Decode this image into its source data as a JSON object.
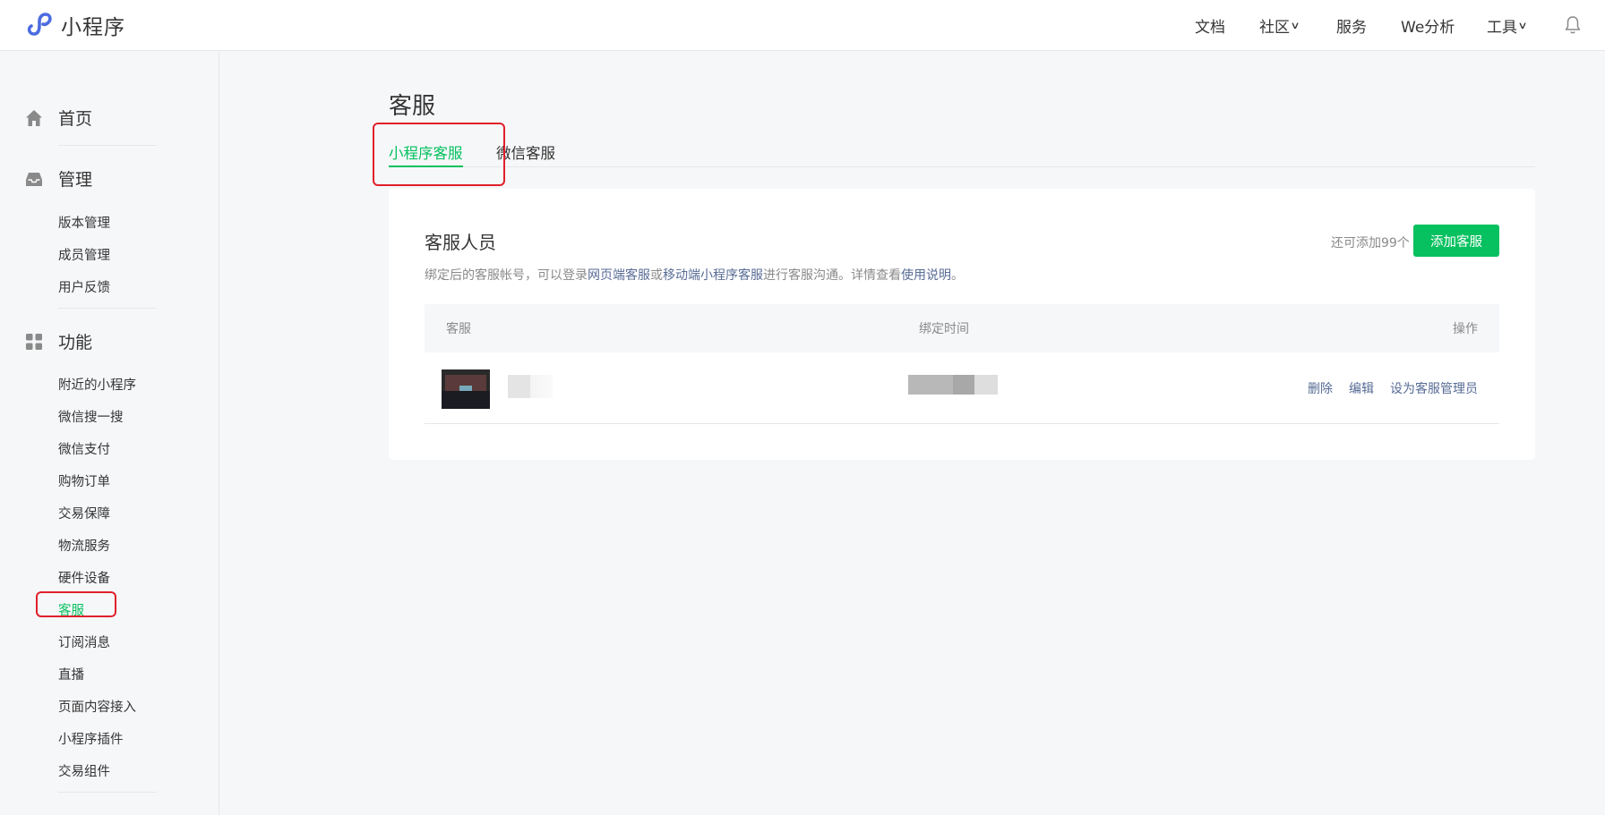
{
  "app": {
    "name": "小程序"
  },
  "topnav": [
    {
      "label": "文档",
      "dropdown": false
    },
    {
      "label": "社区",
      "dropdown": true
    },
    {
      "label": "服务",
      "dropdown": false
    },
    {
      "label": "We分析",
      "dropdown": false
    },
    {
      "label": "工具",
      "dropdown": true
    }
  ],
  "sidebar": {
    "home": "首页",
    "manage": {
      "label": "管理",
      "items": [
        "版本管理",
        "成员管理",
        "用户反馈"
      ]
    },
    "features": {
      "label": "功能",
      "items": [
        "附近的小程序",
        "微信搜一搜",
        "微信支付",
        "购物订单",
        "交易保障",
        "物流服务",
        "硬件设备",
        "客服",
        "订阅消息",
        "直播",
        "页面内容接入",
        "小程序插件",
        "交易组件"
      ],
      "active": "客服"
    }
  },
  "page": {
    "title": "客服",
    "tabs": [
      {
        "label": "小程序客服",
        "active": true
      },
      {
        "label": "微信客服",
        "active": false
      }
    ]
  },
  "card": {
    "title": "客服人员",
    "desc_prefix": "绑定后的客服帐号，可以登录",
    "desc_link1": "网页端客服",
    "desc_or": "或",
    "desc_link2": "移动端小程序客服",
    "desc_mid": "进行客服沟通。详情查看",
    "desc_link3": "使用说明",
    "desc_end": "。",
    "quota": "还可添加99个",
    "add_button": "添加客服",
    "table": {
      "headers": {
        "agent": "客服",
        "bind_time": "绑定时间",
        "actions": "操作"
      },
      "rows": [
        {
          "actions": [
            "删除",
            "编辑",
            "设为客服管理员"
          ]
        }
      ]
    }
  },
  "colors": {
    "accent": "#07c160",
    "link": "#576b95",
    "highlight": "#e0202b"
  }
}
